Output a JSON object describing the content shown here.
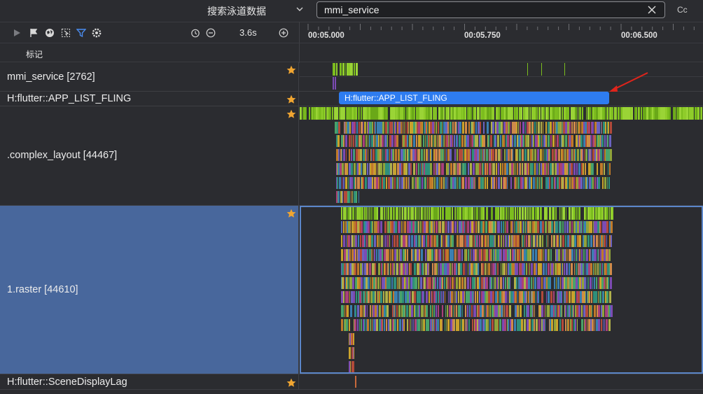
{
  "topbar": {
    "search_scope_label": "搜索泳道数据",
    "search_value": "mmi_service",
    "case_toggle_label": "Cc"
  },
  "toolbar": {
    "zoom_value": "3.6s"
  },
  "ruler": {
    "ticks": [
      "00:05.000",
      "00:05.750",
      "00:06.500"
    ]
  },
  "marks": {
    "label": "标记"
  },
  "lanes": {
    "mmi": {
      "title": "mmi_service [2762]"
    },
    "fling": {
      "title": "H:flutter::APP_LIST_FLING",
      "slice_label": "H:flutter::APP_LIST_FLING"
    },
    "complex": {
      "title": ".complex_layout [44467]"
    },
    "raster": {
      "title": "1.raster [44610]"
    },
    "scene": {
      "title": "H:flutter::SceneDisplayLag"
    }
  },
  "colors": {
    "accent_green": "#7cbd1e",
    "selection_blue": "#48679c",
    "slice_blue": "#2e7cf0",
    "star": "#f0a531",
    "annotation_arrow": "#e0241b"
  }
}
